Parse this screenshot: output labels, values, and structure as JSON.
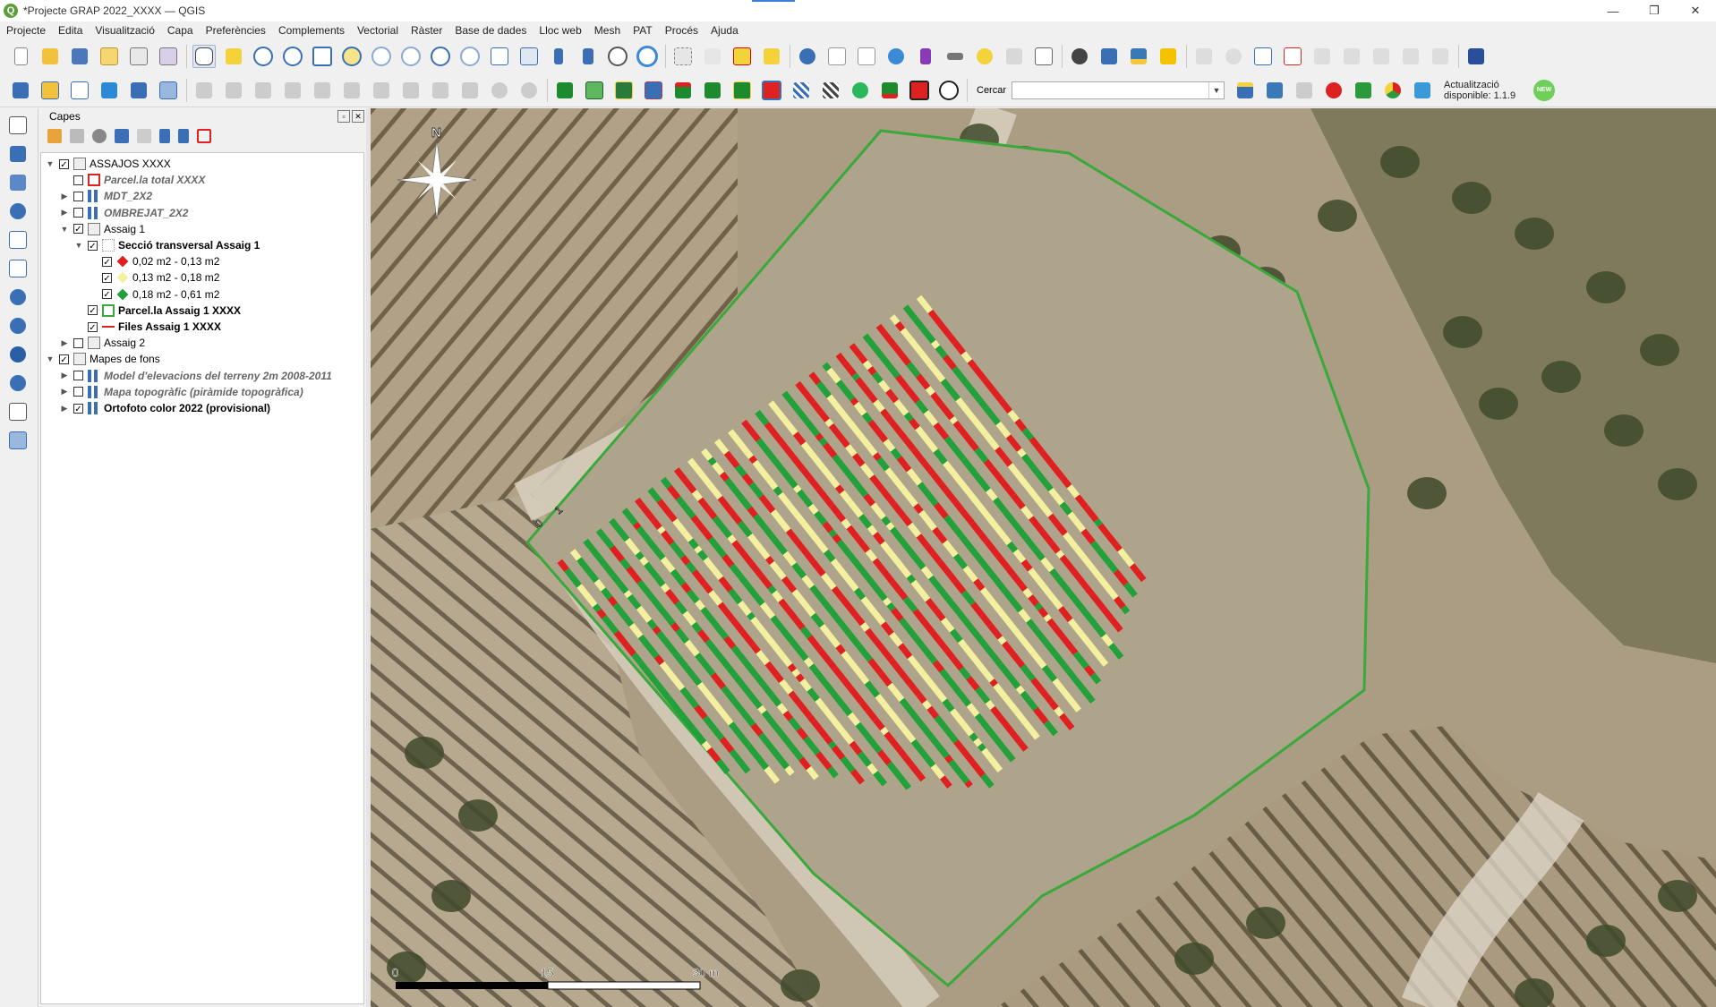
{
  "window": {
    "title": "*Projecte GRAP 2022_XXXX — QGIS",
    "logo_letter": "Q",
    "controls": {
      "minimize": "—",
      "maximize": "❐",
      "close": "✕"
    }
  },
  "menu": [
    "Projecte",
    "Edita",
    "Visualització",
    "Capa",
    "Preferències",
    "Complements",
    "Vectorial",
    "Ràster",
    "Base de dades",
    "Lloc web",
    "Mesh",
    "PAT",
    "Procés",
    "Ajuda"
  ],
  "toolbar2": {
    "search_label": "Cercar",
    "search_value": "",
    "search_dropdown": "▼",
    "update_line1": "Actualització",
    "update_line2": "disponible: 1.1.9",
    "new_badge": "NEW"
  },
  "layers_panel": {
    "title": "Capes",
    "float_btn": "▫",
    "close_btn": "✕"
  },
  "tree": [
    {
      "label": "ASSAJOS XXXX",
      "indent": 0,
      "expander": "▼",
      "checked": true,
      "icon": "group-icon",
      "style": "normal"
    },
    {
      "label": "Parcel.la total XXXX",
      "indent": 1,
      "expander": "",
      "checked": false,
      "icon": "polygon-red-icon",
      "style": "ital"
    },
    {
      "label": "MDT_2X2",
      "indent": 1,
      "expander": "▶",
      "checked": false,
      "icon": "raster-icon",
      "style": "ital"
    },
    {
      "label": "OMBREJAT_2X2",
      "indent": 1,
      "expander": "▶",
      "checked": false,
      "icon": "raster-icon",
      "style": "ital"
    },
    {
      "label": "Assaig 1",
      "indent": 1,
      "expander": "▼",
      "checked": true,
      "icon": "group-icon",
      "style": "normal"
    },
    {
      "label": "Secció transversal Assaig 1",
      "indent": 2,
      "expander": "▼",
      "checked": true,
      "icon": "points-icon",
      "style": "bold"
    },
    {
      "label": "0,02 m2 - 0,13 m2",
      "indent": 3,
      "expander": "",
      "checked": true,
      "icon": "diamond-red-icon",
      "style": "normal"
    },
    {
      "label": "0,13 m2 - 0,18 m2",
      "indent": 3,
      "expander": "",
      "checked": true,
      "icon": "diamond-yellow-icon",
      "style": "normal"
    },
    {
      "label": "0,18 m2 - 0,61 m2",
      "indent": 3,
      "expander": "",
      "checked": true,
      "icon": "diamond-green-icon",
      "style": "normal"
    },
    {
      "label": "Parcel.la Assaig 1 XXXX",
      "indent": 2,
      "expander": "",
      "checked": true,
      "icon": "polygon-green-icon",
      "style": "bold"
    },
    {
      "label": "Files Assaig 1 XXXX",
      "indent": 2,
      "expander": "",
      "checked": true,
      "icon": "line-red-icon",
      "style": "bold"
    },
    {
      "label": "Assaig 2",
      "indent": 1,
      "expander": "▶",
      "checked": false,
      "icon": "group-icon",
      "style": "normal"
    },
    {
      "label": "Mapes de fons",
      "indent": 0,
      "expander": "▼",
      "checked": true,
      "icon": "group-icon",
      "style": "normal"
    },
    {
      "label": "Model d'elevacions del terreny 2m 2008-2011",
      "indent": 1,
      "expander": "▶",
      "checked": false,
      "icon": "raster-icon",
      "style": "ital"
    },
    {
      "label": "Mapa topogràfic (piràmide topogràfica)",
      "indent": 1,
      "expander": "▶",
      "checked": false,
      "icon": "raster-icon",
      "style": "ital"
    },
    {
      "label": "Ortofoto color 2022 (provisional)",
      "indent": 1,
      "expander": "▶",
      "checked": true,
      "icon": "raster-icon",
      "style": "bold"
    }
  ],
  "map": {
    "north_label": "N",
    "row_labels": [
      "0",
      "1"
    ],
    "scalebar": {
      "ticks": [
        "0",
        "15",
        "30 m"
      ]
    },
    "colors": {
      "class_low": "#e02020",
      "class_mid": "#f4f0a0",
      "class_high": "#22a03a",
      "parcel_outline": "#3aa83a"
    }
  }
}
